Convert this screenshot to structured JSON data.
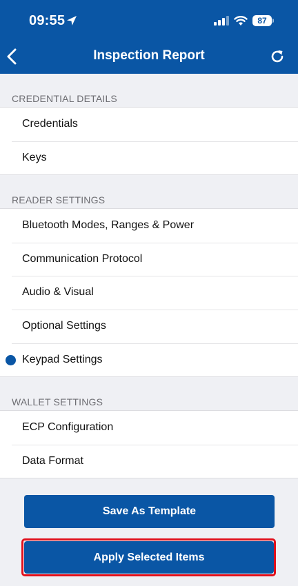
{
  "status_bar": {
    "time": "09:55",
    "battery": "87"
  },
  "nav": {
    "title": "Inspection Report"
  },
  "sections": [
    {
      "header": "CREDENTIAL DETAILS",
      "items": [
        {
          "label": "Credentials"
        },
        {
          "label": "Keys"
        }
      ]
    },
    {
      "header": "READER SETTINGS",
      "items": [
        {
          "label": "Bluetooth Modes, Ranges & Power"
        },
        {
          "label": "Communication Protocol"
        },
        {
          "label": "Audio & Visual"
        },
        {
          "label": "Optional Settings"
        },
        {
          "label": "Keypad Settings",
          "selected": true
        }
      ]
    },
    {
      "header": "WALLET SETTINGS",
      "items": [
        {
          "label": "ECP Configuration"
        },
        {
          "label": "Data Format"
        }
      ]
    }
  ],
  "buttons": {
    "save_template": "Save As Template",
    "apply_selected": "Apply Selected Items"
  },
  "colors": {
    "brand": "#0a56a5",
    "highlight": "#e0101c",
    "background": "#eff0f4"
  }
}
